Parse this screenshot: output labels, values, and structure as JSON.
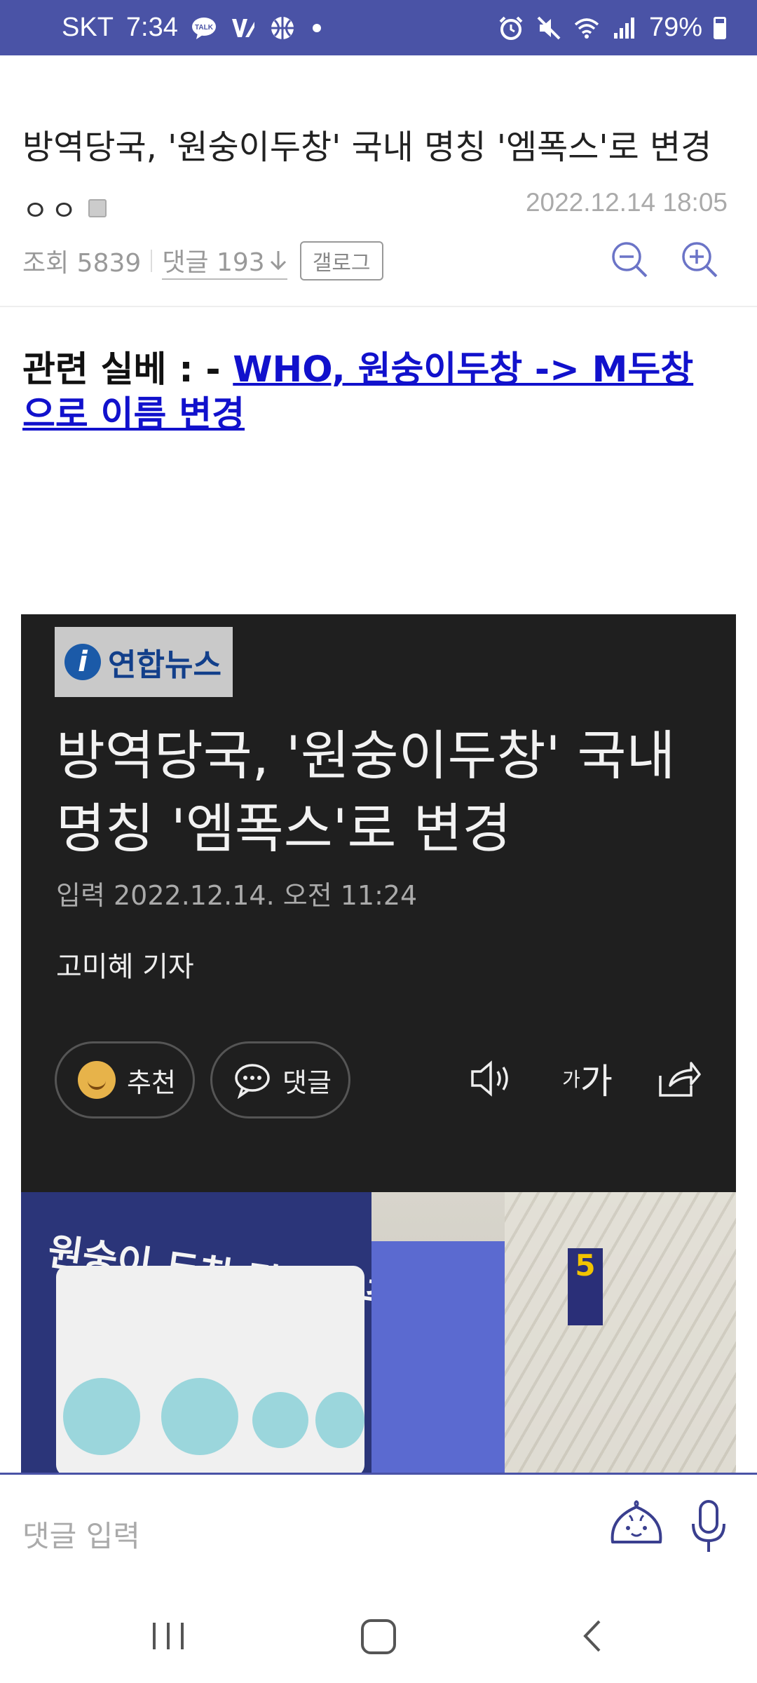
{
  "status_bar": {
    "carrier": "SKT",
    "time": "7:34",
    "battery": "79%",
    "icons": [
      "talk-icon",
      "v3-icon",
      "basketball-icon",
      "dot-icon",
      "alarm-icon",
      "mute-icon",
      "wifi-icon",
      "signal-icon",
      "battery-icon"
    ]
  },
  "post": {
    "title": "방역당국, '원숭이두창' 국내 명칭 '엠폭스'로 변경",
    "author": "ㅇㅇ",
    "date": "2022.12.14 18:05",
    "views_label": "조회 5839",
    "comments_label": "댓글 193",
    "gallog_label": "갤로그"
  },
  "related": {
    "prefix": "관련 실베 : - ",
    "link_text": "WHO, 원숭이두창 -> M두창으로 이름 변경"
  },
  "news_card": {
    "logo_text": "연합뉴스",
    "headline": "방역당국, '원숭이두창' 국내 명칭 '엠폭스'로 변경",
    "date": "입력 2022.12.14. 오전 11:24",
    "reporter": "고미혜 기자",
    "recommend_label": "추천",
    "comment_label": "댓글",
    "font_tool_small": "가",
    "font_tool_large": "가"
  },
  "photo": {
    "banner_text": "원숭이 두창 감염병 주의",
    "sign_text": "5"
  },
  "comment_bar": {
    "placeholder": "댓글 입력"
  },
  "colors": {
    "status_bar": "#4a53a6",
    "link": "#1111cc",
    "card_bg": "#1f1f1f"
  }
}
